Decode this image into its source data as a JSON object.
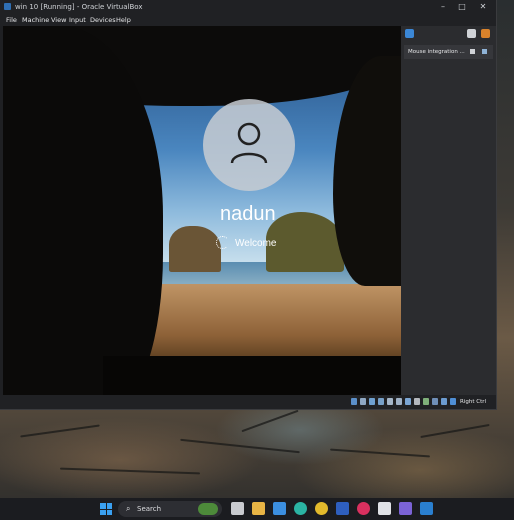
{
  "window": {
    "title": "win 10 [Running] - Oracle VirtualBox",
    "minimize": "–",
    "maximize": "□",
    "close": "✕"
  },
  "menu": [
    "File",
    "Machine",
    "View",
    "Input",
    "Devices",
    "Help"
  ],
  "guest": {
    "username": "nadun",
    "status": "Welcome"
  },
  "notification_panel": {
    "message": "Mouse integration ..."
  },
  "statusbar": {
    "host_key": "Right Ctrl"
  },
  "taskbar": {
    "search_label": "Search",
    "apps": [
      "task-view",
      "file-explorer",
      "microsoft-store",
      "edge",
      "chrome",
      "l-app",
      "media-player",
      "virtualbox",
      "photos",
      "vscode"
    ]
  },
  "colors": {
    "titlebar": "#202124",
    "sidepanel": "#2b2c2f",
    "accent_blue": "#3aa0f0"
  }
}
